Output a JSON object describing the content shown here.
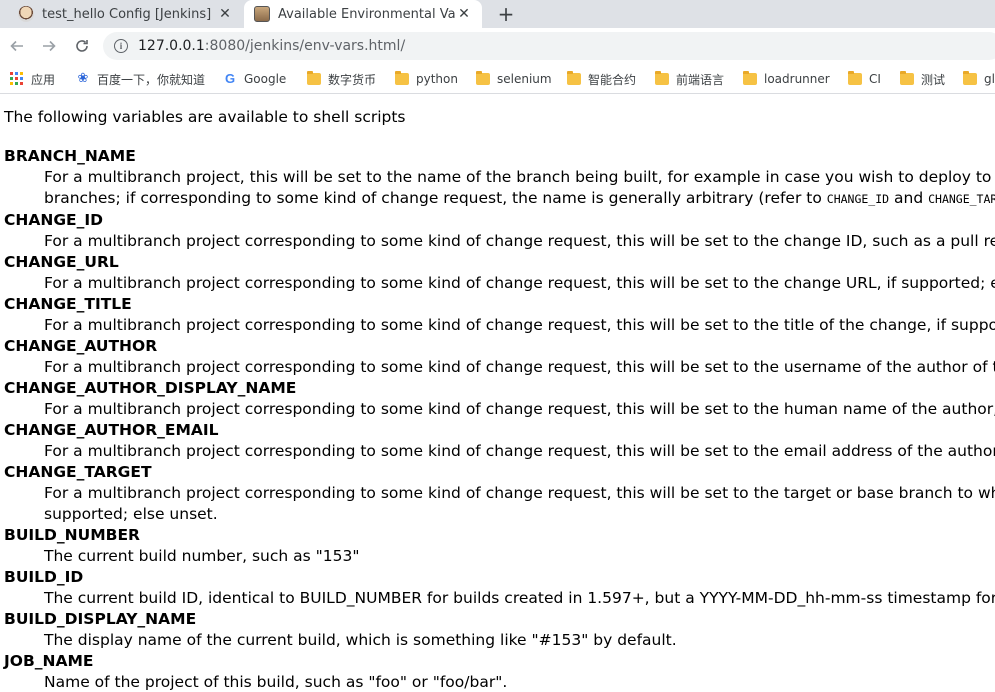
{
  "browser": {
    "tabs": [
      {
        "title": "test_hello Config [Jenkins]",
        "active": false
      },
      {
        "title": "Available Environmental Variables",
        "active": true
      }
    ],
    "new_tab_symbol": "+",
    "close_symbol": "✕",
    "url": {
      "host": "127.0.0.1",
      "path": ":8080/jenkins/env-vars.html/"
    },
    "bookmarks": [
      {
        "label": "应用",
        "icon": "apps-grid-icon"
      },
      {
        "label": "百度一下，你就知道",
        "icon": "baidu-paw-icon"
      },
      {
        "label": "Google",
        "icon": "google-icon"
      },
      {
        "label": "数字货币",
        "icon": "folder-icon"
      },
      {
        "label": "python",
        "icon": "folder-icon"
      },
      {
        "label": "selenium",
        "icon": "folder-icon"
      },
      {
        "label": "智能合约",
        "icon": "folder-icon"
      },
      {
        "label": "前端语言",
        "icon": "folder-icon"
      },
      {
        "label": "loadrunner",
        "icon": "folder-icon"
      },
      {
        "label": "CI",
        "icon": "folder-icon"
      },
      {
        "label": "测试",
        "icon": "folder-icon"
      },
      {
        "label": "gl",
        "icon": "folder-icon"
      }
    ],
    "colors": {
      "tabstrip": "#dee1e6",
      "omnibox": "#f1f3f4",
      "folder": "#f6c244"
    }
  },
  "page": {
    "intro": "The following variables are available to shell scripts",
    "variables": [
      {
        "name": "BRANCH_NAME",
        "desc": [
          "For a multibranch project, this will be set to the name of the branch being built, for example in case you wish to deploy to pr",
          "branches; if corresponding to some kind of change request, the name is generally arbitrary (refer to ",
          "CHANGE_ID",
          " and ",
          "CHANGE_TARGET",
          ")"
        ]
      },
      {
        "name": "CHANGE_ID",
        "desc": [
          "For a multibranch project corresponding to some kind of change request, this will be set to the change ID, such as a pull req"
        ]
      },
      {
        "name": "CHANGE_URL",
        "desc": [
          "For a multibranch project corresponding to some kind of change request, this will be set to the change URL, if supported; els"
        ]
      },
      {
        "name": "CHANGE_TITLE",
        "desc": [
          "For a multibranch project corresponding to some kind of change request, this will be set to the title of the change, if suppor"
        ]
      },
      {
        "name": "CHANGE_AUTHOR",
        "desc": [
          "For a multibranch project corresponding to some kind of change request, this will be set to the username of the author of th"
        ]
      },
      {
        "name": "CHANGE_AUTHOR_DISPLAY_NAME",
        "desc": [
          "For a multibranch project corresponding to some kind of change request, this will be set to the human name of the author, i"
        ]
      },
      {
        "name": "CHANGE_AUTHOR_EMAIL",
        "desc": [
          "For a multibranch project corresponding to some kind of change request, this will be set to the email address of the author,"
        ]
      },
      {
        "name": "CHANGE_TARGET",
        "desc": [
          "For a multibranch project corresponding to some kind of change request, this will be set to the target or base branch to whic",
          "supported; else unset."
        ]
      },
      {
        "name": "BUILD_NUMBER",
        "desc": [
          "The current build number, such as \"153\""
        ]
      },
      {
        "name": "BUILD_ID",
        "desc": [
          "The current build ID, identical to BUILD_NUMBER for builds created in 1.597+, but a YYYY-MM-DD_hh-mm-ss timestamp for"
        ]
      },
      {
        "name": "BUILD_DISPLAY_NAME",
        "desc": [
          "The display name of the current build, which is something like \"#153\" by default."
        ]
      },
      {
        "name": "JOB_NAME",
        "desc": [
          "Name of the project of this build, such as \"foo\" or \"foo/bar\"."
        ]
      }
    ]
  }
}
